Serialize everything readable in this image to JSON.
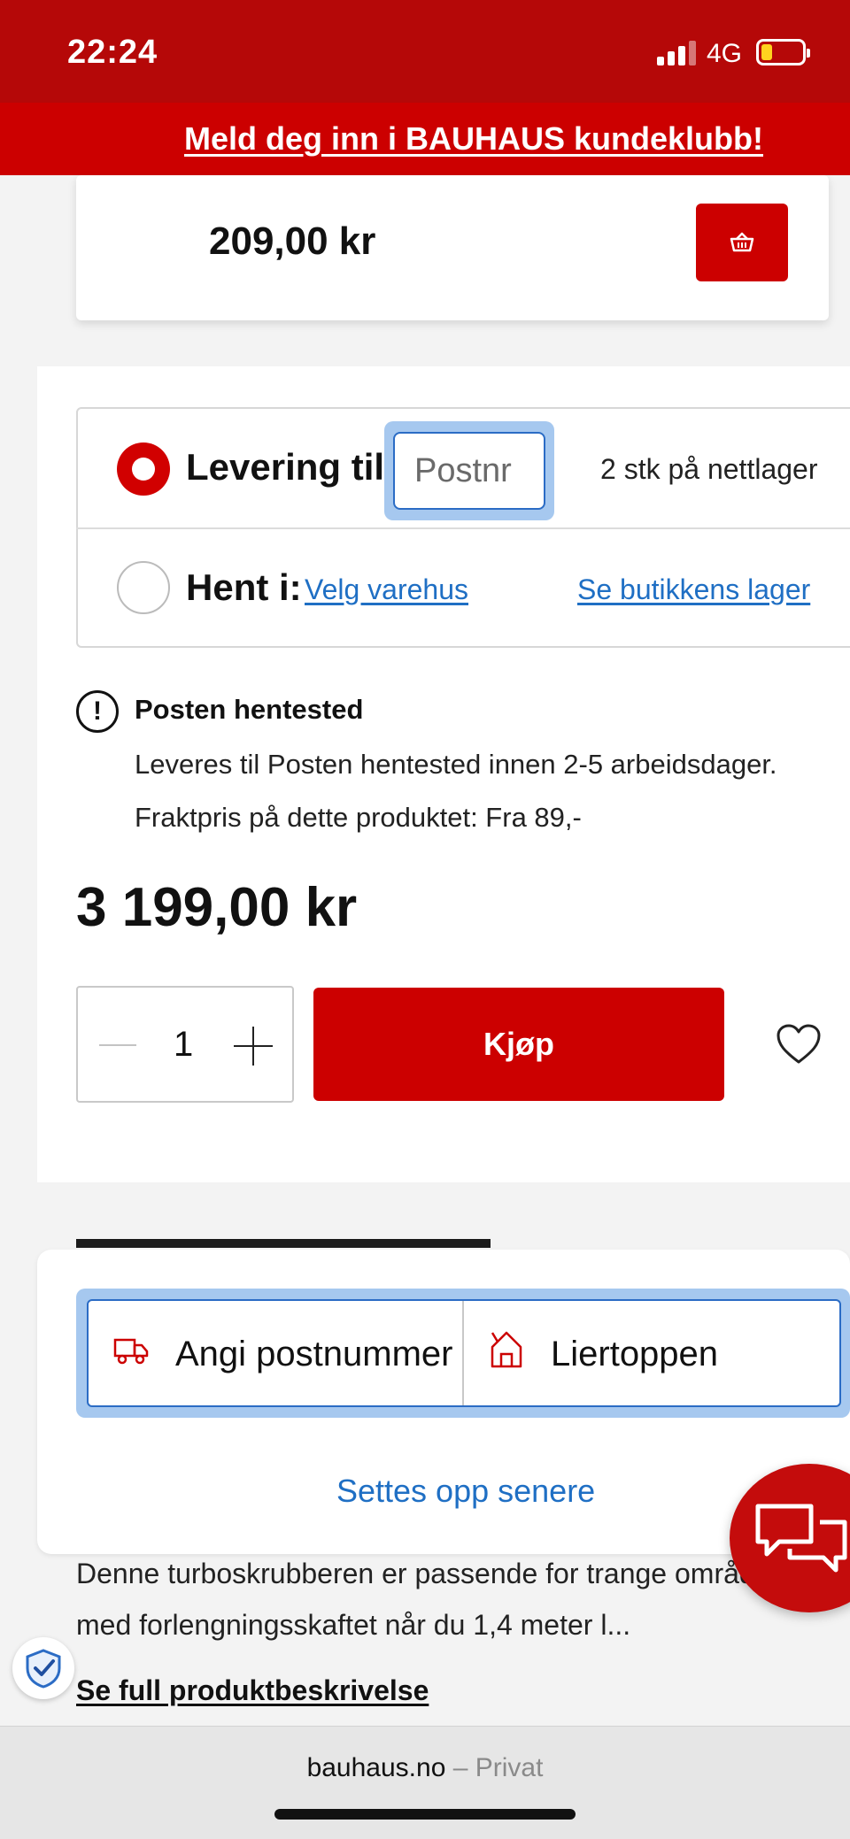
{
  "status_bar": {
    "time": "22:24",
    "network": "4G"
  },
  "banner": {
    "club_link": "Meld deg inn i BAUHAUS kundeklubb!"
  },
  "mini_product": {
    "price": "209,00 kr"
  },
  "delivery": {
    "levering_label": "Levering til:",
    "postnr_placeholder": "Postnr",
    "stock_text": "2 stk på nettlager",
    "hent_label": "Hent i:",
    "velg_varehus": "Velg varehus",
    "se_butikkens_lager": "Se butikkens lager",
    "selected_option": "levering"
  },
  "info": {
    "title": "Posten hentested",
    "line1": "Leveres til Posten hentested innen 2-5 arbeidsdager.",
    "line2": "Fraktpris på dette produktet: Fra 89,-"
  },
  "product": {
    "price": "3 199,00 kr",
    "quantity": "1",
    "buy_label": "Kjøp"
  },
  "store_picker": {
    "postnummer_label": "Angi postnummer",
    "store_label": "Liertoppen",
    "later_label": "Settes opp senere"
  },
  "description": {
    "line1": "Denne turboskrubberen er passende for trange områder",
    "line2": "med forlengningsskaftet når du 1,4 meter l...",
    "full_link": "Se full produktbeskrivelse"
  },
  "browser": {
    "domain": "bauhaus.no",
    "separator": " – ",
    "mode": "Privat"
  },
  "colors": {
    "brand_red": "#cc0000",
    "link_blue": "#1f6fc4",
    "focus_blue": "#a6c8ef"
  }
}
